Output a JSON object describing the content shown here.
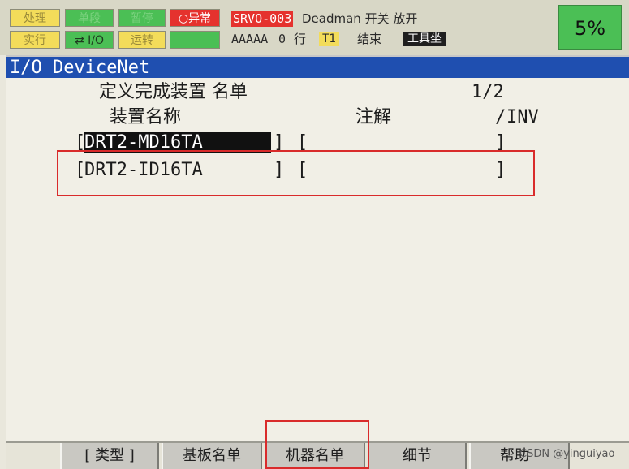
{
  "status_leds": {
    "row1": [
      "处理",
      "单段",
      "暂停",
      "异常"
    ],
    "row2": [
      "实行",
      "I/O",
      "运转",
      ""
    ]
  },
  "alarm": {
    "code": "SRVO-003",
    "message": "Deadman  开关 放开",
    "program": "AAAAA",
    "line_no": "0",
    "line_label": "行",
    "mode": "T1",
    "state": "结束",
    "frame": "工具坐"
  },
  "override": "5%",
  "screen": {
    "title": "I/O DeviceNet",
    "subtitle": "定义完成装置 名单",
    "page": "1/2",
    "columns": {
      "name": "装置名称",
      "comment": "注解",
      "inv": "INV"
    },
    "devices": [
      {
        "name": "DRT2-MD16TA",
        "comment": ""
      },
      {
        "name": "DRT2-ID16TA",
        "comment": ""
      }
    ]
  },
  "function_keys": [
    "[ 类型 ]",
    "基板名单",
    "机器名单",
    "细节",
    "帮助"
  ],
  "watermark": "CSDN @yinguiyao",
  "colors": {
    "title_bar": "#1f4fb0",
    "alarm": "#e5322e",
    "led_yellow": "#f3dc5a",
    "led_green": "#4bbf55",
    "highlight": "#d92b2b"
  }
}
